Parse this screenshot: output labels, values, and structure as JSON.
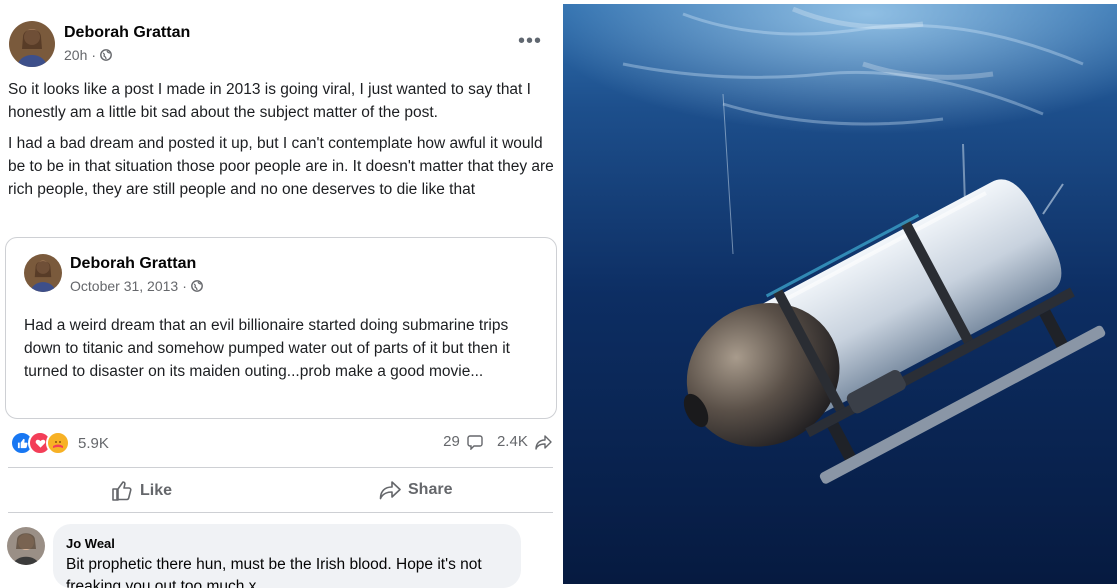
{
  "post": {
    "author": "Deborah Grattan",
    "time": "20h",
    "more_label": "•••",
    "paragraphs": [
      "So it looks like a post I made in 2013 is going viral, I just wanted to say that I honestly am a little bit sad about the subject matter of the post.",
      "I had a bad dream and posted it up, but I can't contemplate how awful it would be to be in that situation those poor people are in. It doesn't matter that they are rich people, they are still people and no one deserves to die like that"
    ]
  },
  "shared_post": {
    "author": "Deborah Grattan",
    "date": "October 31, 2013",
    "text": "Had a weird dream that an evil billionaire started doing submarine trips down to titanic and somehow pumped water out of parts of it but then it turned to disaster on its maiden outing...prob make a good movie..."
  },
  "reactions": {
    "count": "5.9K",
    "comments": "29",
    "shares": "2.4K"
  },
  "actions": {
    "like": "Like",
    "share": "Share"
  },
  "comment": {
    "author": "Jo Weal",
    "text": "Bit prophetic there hun, must be the Irish blood. Hope it's not freaking you out too much x"
  },
  "colors": {
    "like_blue": "#1877f2",
    "love_red": "#f33e58",
    "care_yellow": "#f7b125",
    "secondary_text": "#65676b",
    "ocean": "#0a2a5c"
  }
}
